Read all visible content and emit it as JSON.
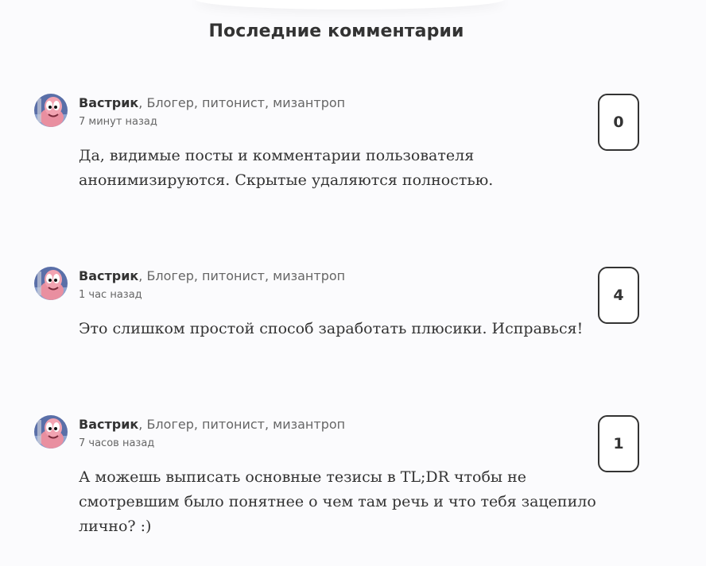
{
  "section": {
    "title": "Последние комментарии"
  },
  "comments": [
    {
      "author": "Вастрик",
      "bio": ", Блогер, питонист, мизантроп",
      "time": "7 минут назад",
      "text": "Да, видимые посты и комментарии пользователя анонимизируются. Скрытые удаляются полностью.",
      "upvotes": "0"
    },
    {
      "author": "Вастрик",
      "bio": ", Блогер, питонист, мизантроп",
      "time": "1 час назад",
      "text": "Это слишком простой способ заработать плюсики. Исправься!",
      "upvotes": "4"
    },
    {
      "author": "Вастрик",
      "bio": ", Блогер, питонист, мизантроп",
      "time": "7 часов назад",
      "text": "А можешь выписать основные тезисы в TL;DR чтобы не смотревшим было понятнее о чем там речь и что тебя зацепило лично? :)",
      "upvotes": "1"
    }
  ]
}
